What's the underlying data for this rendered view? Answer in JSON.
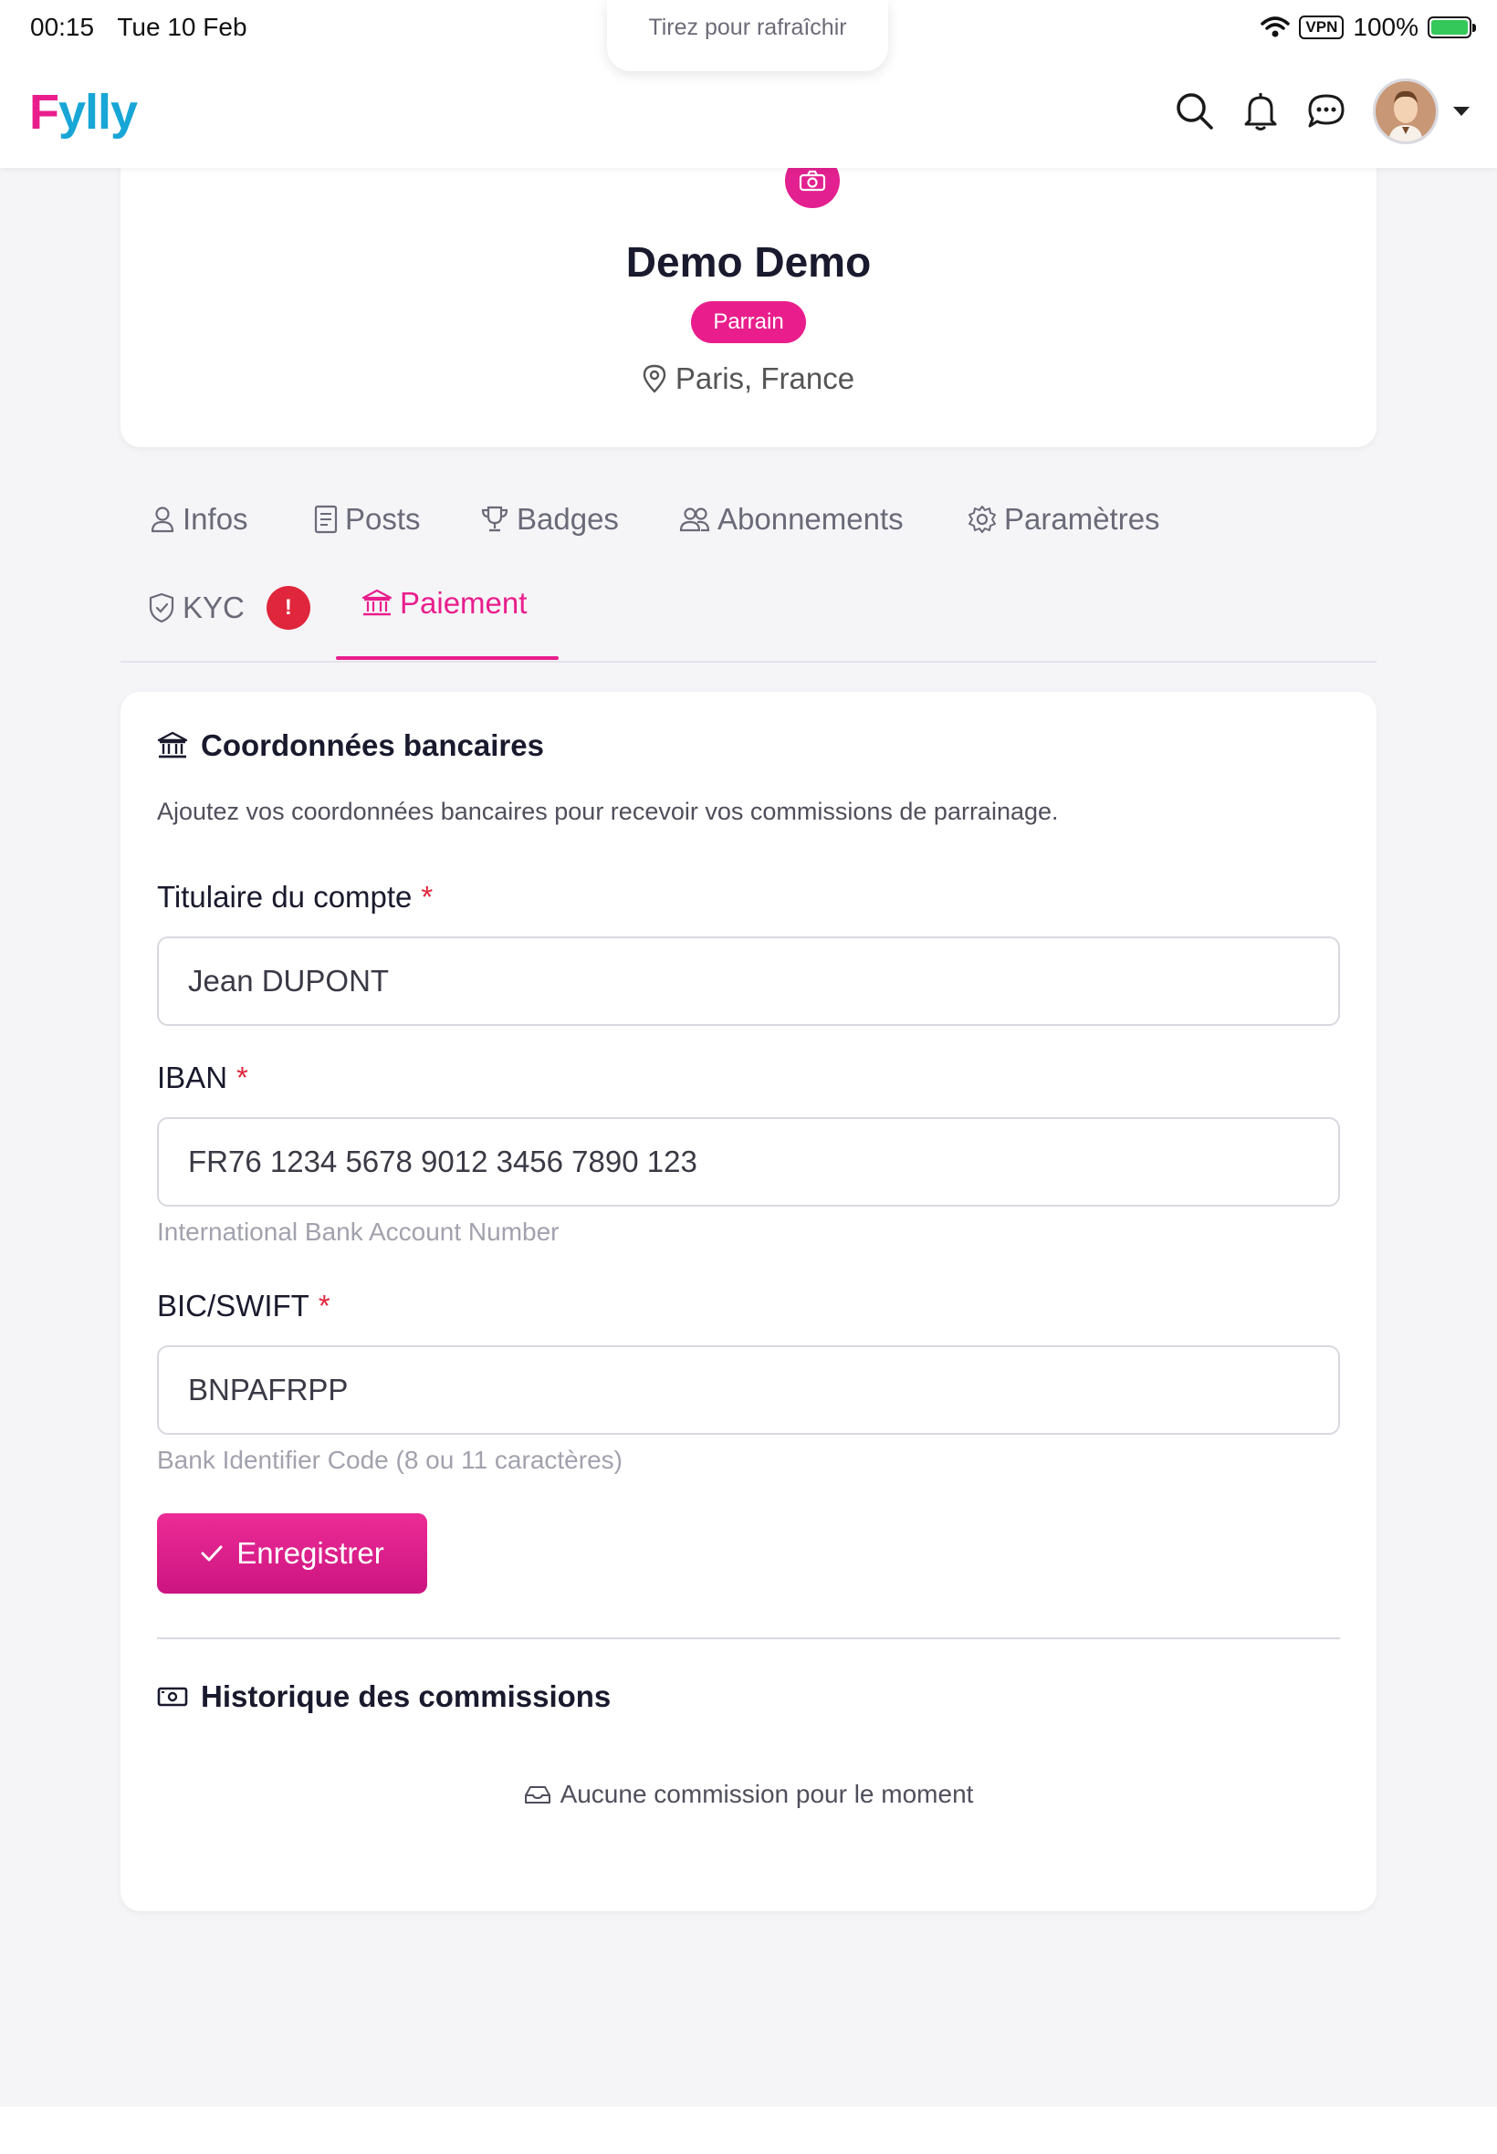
{
  "status_bar": {
    "time": "00:15",
    "date": "Tue 10 Feb",
    "vpn": "VPN",
    "battery": "100%"
  },
  "pull_refresh": "Tirez pour rafraîchir",
  "header": {
    "logo_first": "F",
    "logo_rest": "ylly"
  },
  "profile": {
    "name": "Demo Demo",
    "badge": "Parrain",
    "location": "Paris, France"
  },
  "tabs": [
    {
      "label": "Infos"
    },
    {
      "label": "Posts"
    },
    {
      "label": "Badges"
    },
    {
      "label": "Abonnements"
    },
    {
      "label": "Paramètres"
    },
    {
      "label": "KYC",
      "alert": "!"
    },
    {
      "label": "Paiement",
      "active": true
    }
  ],
  "bank": {
    "title": "Coordonnées bancaires",
    "description": "Ajoutez vos coordonnées bancaires pour recevoir vos commissions de parrainage.",
    "holder": {
      "label": "Titulaire du compte",
      "required": "*",
      "value": "Jean DUPONT"
    },
    "iban": {
      "label": "IBAN",
      "required": "*",
      "value": "FR76 1234 5678 9012 3456 7890 123",
      "help": "International Bank Account Number"
    },
    "bic": {
      "label": "BIC/SWIFT",
      "required": "*",
      "value": "BNPAFRPP",
      "help": "Bank Identifier Code (8 ou 11 caractères)"
    },
    "save_label": "Enregistrer"
  },
  "history": {
    "title": "Historique des commissions",
    "empty": "Aucune commission pour le moment"
  },
  "colors": {
    "accent": "#e91e8c",
    "logo_blue": "#17a6d6",
    "alert_red": "#e0263c"
  }
}
